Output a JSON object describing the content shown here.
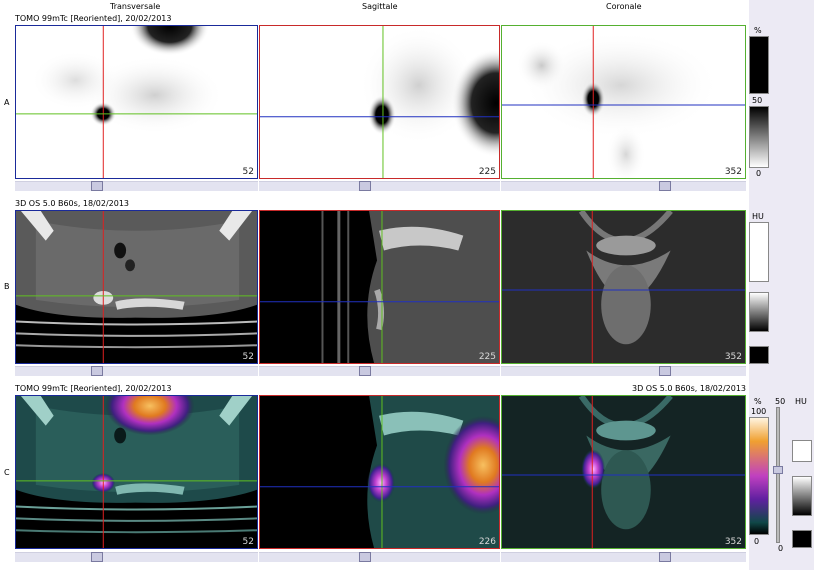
{
  "headers": {
    "transversal": "Transversale",
    "sagittal": "Sagittale",
    "coronal": "Coronale"
  },
  "rows": {
    "a": {
      "label": "A",
      "info": "TOMO 99mTc [Reoriented], 20/02/2013",
      "slices": [
        "52",
        "225",
        "352"
      ],
      "scale": {
        "unit": "%",
        "mid": "50",
        "min": "0"
      }
    },
    "b": {
      "label": "B",
      "info": "3D OS 5.0 B60s, 18/02/2013",
      "slices": [
        "52",
        "225",
        "352"
      ],
      "scale": {
        "unit": "HU"
      }
    },
    "c": {
      "label": "C",
      "info_left": "TOMO 99mTc [Reoriented], 20/02/2013",
      "info_right": "3D OS 5.0 B60s, 18/02/2013",
      "slices": [
        "52",
        "226",
        "352"
      ],
      "scale": {
        "unit": "%",
        "max": "100",
        "min": "0",
        "mid": "50",
        "min2": "0",
        "unit2": "HU"
      }
    }
  },
  "colors": {
    "transversal_border": "#1a2a9a",
    "sagittal_border": "#c82a2a",
    "coronal_border": "#55b030",
    "crosshair_red": "#e02020",
    "crosshair_green": "#60c020",
    "crosshair_blue": "#2030c0"
  }
}
